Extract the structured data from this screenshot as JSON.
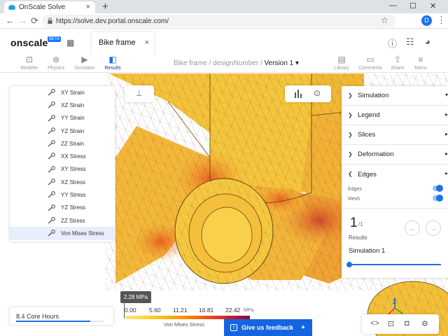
{
  "browser": {
    "tab_title": "OnScale Solve",
    "tab_close": "×",
    "new_tab": "+",
    "url": "https://solve.dev.portal.onscale.com/",
    "profile_initial": "D",
    "window_controls": [
      "—",
      "☐",
      "✕"
    ]
  },
  "app": {
    "logo": "onscale",
    "beta": "BETA",
    "project_tab": "Bike frame",
    "tab_close": "×"
  },
  "toolbar": {
    "left": [
      {
        "label": "Modeler",
        "icon": "modeler-icon"
      },
      {
        "label": "Physics",
        "icon": "physics-icon"
      },
      {
        "label": "Simulator",
        "icon": "simulator-icon"
      },
      {
        "label": "Results",
        "icon": "results-icon",
        "active": true
      }
    ],
    "breadcrumb": [
      "Bike frame",
      "designNumber",
      "Version 1"
    ],
    "right": [
      {
        "label": "Library",
        "icon": "library-icon"
      },
      {
        "label": "Comments",
        "icon": "comments-icon"
      },
      {
        "label": "Share",
        "icon": "share-icon"
      },
      {
        "label": "Menu",
        "icon": "menu-icon"
      }
    ]
  },
  "result_list": {
    "items": [
      "XY Strain",
      "XZ Strain",
      "YY Strain",
      "YZ Strain",
      "ZZ Strain",
      "XX Stress",
      "XY Stress",
      "XZ Stress",
      "YY Stress",
      "YZ Stress",
      "ZZ Stress",
      "Von Mises Stress"
    ],
    "selected": "Von Mises Stress"
  },
  "right_panel": {
    "sections": [
      "Simulation",
      "Legend",
      "Slices",
      "Deformation",
      "Edges"
    ],
    "edges_options": [
      {
        "label": "Edges",
        "on": true
      },
      {
        "label": "Mesh",
        "on": true
      }
    ],
    "result_index": "1",
    "result_total": "/1",
    "results_label": "Results",
    "simulation_name": "Simulation 1"
  },
  "legend": {
    "probe_value": "2.28 MPa",
    "ticks": [
      "0.00",
      "5.60",
      "11.21",
      "16.81",
      "22.42"
    ],
    "units": "MPa",
    "title": "Von Mises Stress",
    "colors": [
      "#ffe77a",
      "#ffca28",
      "#ff9500",
      "#f04a1a",
      "#c51a34",
      "#7b1038"
    ]
  },
  "status": {
    "core_hours": "8.4 Core Hours",
    "core_hours_fraction": 0.85,
    "feedback": "Give us feedback"
  },
  "triad": {
    "axis": "Z"
  },
  "colors": {
    "accent": "#1a73e8",
    "feedback_bg": "#1565e0",
    "model_yellow": "#f4c23a"
  }
}
